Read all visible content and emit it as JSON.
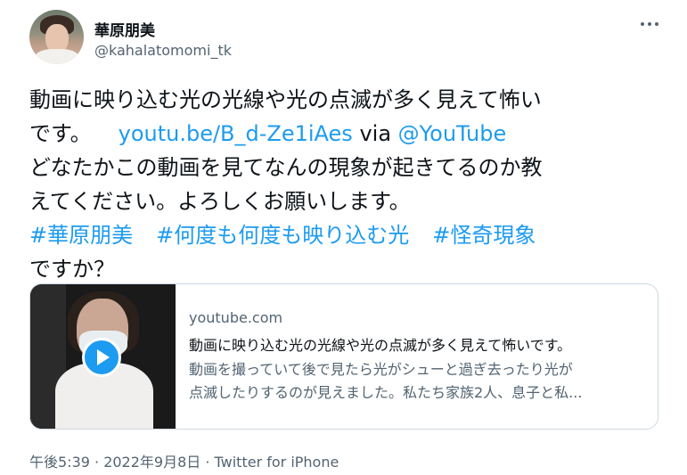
{
  "user": {
    "display_name": "華原朋美",
    "handle": "@kahalatomomi_tk"
  },
  "tweet": {
    "line1": "動画に映り込む光の光線や光の点滅が多く見えて怖い",
    "line2_text": "です。",
    "line2_link": "youtu.be/B_d-Ze1iAes",
    "line2_via": "via",
    "line2_mention": "@YouTube",
    "line3": "どなたかこの動画を見てなんの現象が起きてるのか教",
    "line4": "えてください。よろしくお願いします。",
    "hashtags": [
      "#華原朋美",
      "#何度も何度も映り込む光",
      "#怪奇現象"
    ],
    "line6": "ですか？"
  },
  "card": {
    "domain": "youtube.com",
    "title": "動画に映り込む光の光線や光の点滅が多く見えて怖いです。",
    "desc_line1": "動画を撮っていて後で見たら光がシューと過ぎ去ったり光が",
    "desc_line2": "点滅したりするのが見えました。私たち家族2人、息子と私..."
  },
  "meta": {
    "timestamp": "午後5:39 · 2022年9月8日 · Twitter for iPhone"
  },
  "icons": {
    "more": "more-options-icon",
    "play": "play-icon"
  },
  "colors": {
    "link": "#1d9bf0",
    "secondary_text": "#536471",
    "primary_text": "#0f1419"
  }
}
